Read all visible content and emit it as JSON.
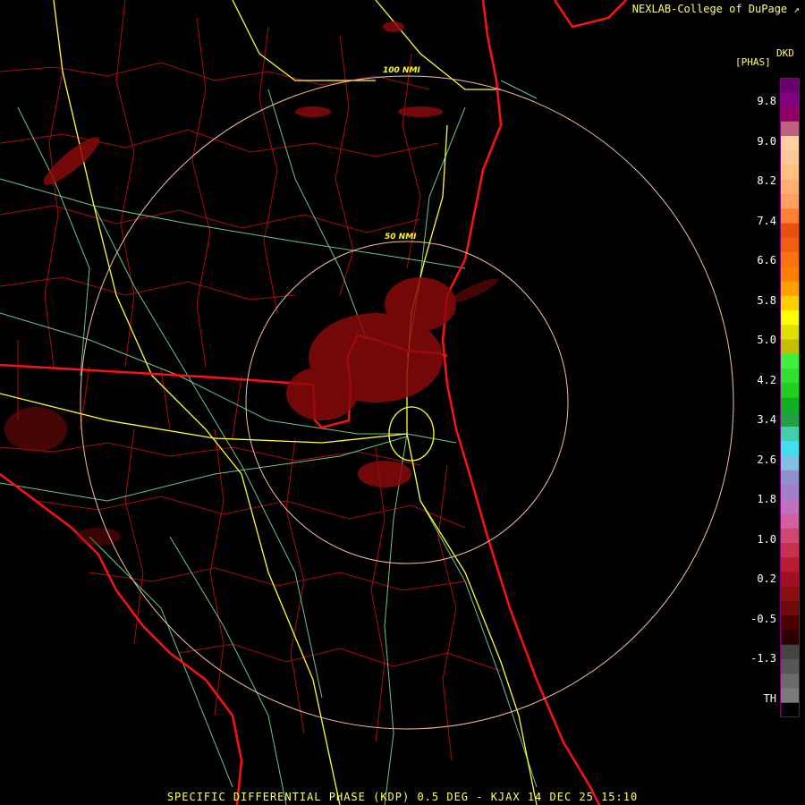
{
  "header": {
    "credit": "NEXLAB-College of DuPage",
    "credit_icon": "arrow-icon"
  },
  "legend": {
    "unit_top": "DKD",
    "unit_bottom": "[PHAS]",
    "ticks": [
      "9.8",
      "9.0",
      "8.2",
      "7.4",
      "6.6",
      "5.8",
      "5.0",
      "4.2",
      "3.4",
      "2.6",
      "1.8",
      "1.0",
      "0.2",
      "-0.5",
      "-1.3",
      "TH"
    ],
    "colors": [
      "#000000",
      "#7a7a7a",
      "#6a6a6a",
      "#565656",
      "#444444",
      "#2a0000",
      "#4a0000",
      "#6e0a0a",
      "#8a1010",
      "#a01020",
      "#b81c30",
      "#c83050",
      "#d04870",
      "#d060a0",
      "#c070c0",
      "#a080c8",
      "#9090d0",
      "#80c0e0",
      "#40e0f0",
      "#40d0b0",
      "#20a040",
      "#10b020",
      "#20d020",
      "#30e030",
      "#40f040",
      "#c0c000",
      "#e0e000",
      "#ffff00",
      "#ffd000",
      "#ffa000",
      "#ff8000",
      "#ff7010",
      "#f06010",
      "#e85010",
      "#ff8030",
      "#ffa060",
      "#ffb070",
      "#ffc080",
      "#ffc898",
      "#ffd0a0",
      "#c06080",
      "#900060",
      "#800080",
      "#6a006a"
    ]
  },
  "map": {
    "rings": [
      {
        "label": "50 NMI"
      },
      {
        "label": "100 NMI"
      }
    ],
    "colors": {
      "state_border": "#ff1010",
      "county_border": "#cc1010",
      "highway": "#ffff33",
      "road": "#80e8a0",
      "ring": "#f0c0a0",
      "echo": "#8a0a0a"
    }
  },
  "footer": {
    "caption": "SPECIFIC DIFFERENTIAL PHASE (KDP) 0.5 DEG - KJAX 14 DEC 25 15:10"
  }
}
